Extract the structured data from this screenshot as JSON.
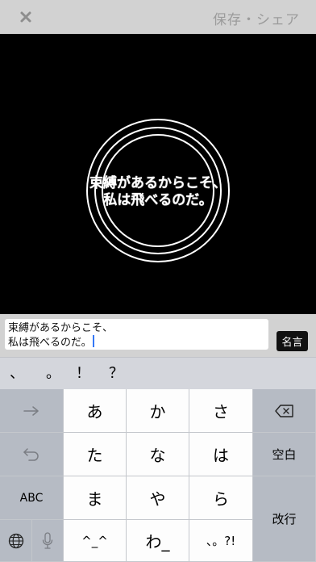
{
  "topbar": {
    "close_icon": "close-x-icon",
    "save_share": "保存・シェア"
  },
  "canvas": {
    "quote_lines": [
      "束縛があるからこそ、",
      "私は飛べるのだ。"
    ]
  },
  "input": {
    "lines": [
      "束縛があるからこそ、",
      "私は飛べるのだ。"
    ],
    "meigen_button": "名言"
  },
  "suggestions": [
    "、",
    "。",
    "！",
    "？"
  ],
  "keyboard": {
    "row1": {
      "left_icon": "arrow-right-icon",
      "keys": [
        "あ",
        "か",
        "さ"
      ],
      "right_icon": "delete-backspace-icon"
    },
    "row2": {
      "left_icon": "undo-icon",
      "keys": [
        "た",
        "な",
        "は"
      ],
      "right_label": "空白"
    },
    "row3": {
      "left_label": "ABC",
      "keys": [
        "ま",
        "や",
        "ら"
      ],
      "right_label": "改行"
    },
    "row4": {
      "globe_icon": "globe-icon",
      "mic_icon": "microphone-icon",
      "keys": [
        "^_^",
        "わ_",
        "、。?!"
      ]
    }
  },
  "colors": {
    "canvas_bg": "#000000",
    "ring": "#ffffff",
    "caret": "#3478f6",
    "fn_key_bg": "#b6bbc4",
    "char_key_bg": "#fdfdfd"
  }
}
